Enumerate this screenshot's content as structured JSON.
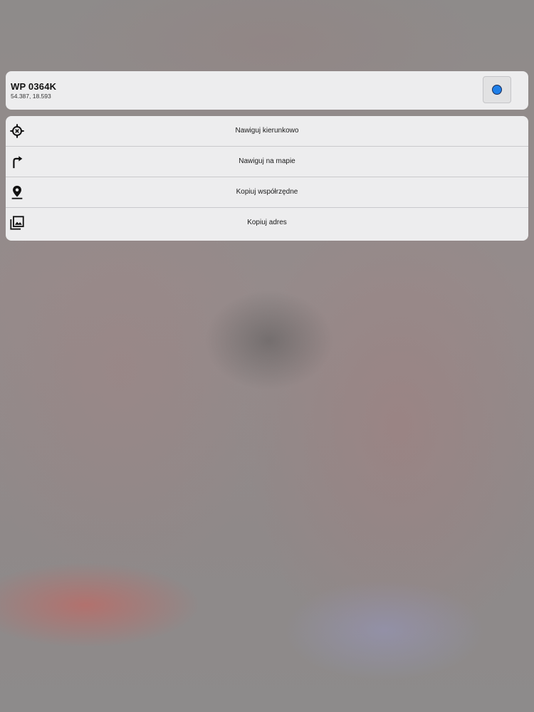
{
  "waypoint": {
    "title": "WP 0364K",
    "coordinates": "54.387, 18.593",
    "color": "#1f7fe8"
  },
  "menu": {
    "items": [
      {
        "label": "Nawiguj kierunkowo",
        "icon": "crosshair-icon"
      },
      {
        "label": "Nawiguj na mapie",
        "icon": "turn-right-arrow-icon"
      },
      {
        "label": "Kopiuj współrzędne",
        "icon": "location-pin-icon"
      },
      {
        "label": "Kopiuj adres",
        "icon": "image-copy-icon"
      }
    ]
  }
}
